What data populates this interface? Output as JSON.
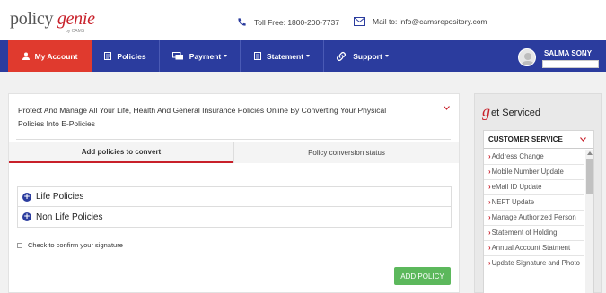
{
  "header": {
    "logo_brand_a": "policy",
    "logo_brand_b": "genie",
    "logo_by": "by CAMS",
    "toll_free": "Toll Free: 1800-200-7737",
    "mail": "Mail to: info@camsrepository.com"
  },
  "nav": {
    "items": [
      {
        "label": "My Account",
        "icon": "user-icon"
      },
      {
        "label": "Policies",
        "icon": "document-icon"
      },
      {
        "label": "Payment",
        "icon": "payment-icon"
      },
      {
        "label": "Statement",
        "icon": "statement-icon"
      },
      {
        "label": "Support",
        "icon": "support-link-icon"
      }
    ],
    "user_name": "SALMA SONY"
  },
  "main": {
    "title": "Protect And Manage All Your Life, Health And General Insurance Policies Online By Converting Your Physical Policies Into E-Policies",
    "tabs": [
      {
        "label": "Add policies to convert",
        "active": true
      },
      {
        "label": "Policy conversion status",
        "active": false
      }
    ],
    "accordion": [
      {
        "label": "Life Policies"
      },
      {
        "label": "Non Life Policies"
      }
    ],
    "confirm_label": "Check to confirm your signature",
    "add_button": "ADD POLICY"
  },
  "side": {
    "head_g": "g",
    "head_text": "et Serviced",
    "section_title": "CUSTOMER SERVICE",
    "items": [
      "Address Change",
      "Mobile Number Update",
      "eMail ID Update",
      "NEFT Update",
      "Manage Authorized Person",
      "Statement of Holding",
      "Annual Account Statment",
      "Update Signature and Photo"
    ]
  },
  "colors": {
    "nav_bg": "#2b3c9e",
    "active_nav": "#e03a2e",
    "accent_red": "#c8202a",
    "button_green": "#5cb85c"
  }
}
